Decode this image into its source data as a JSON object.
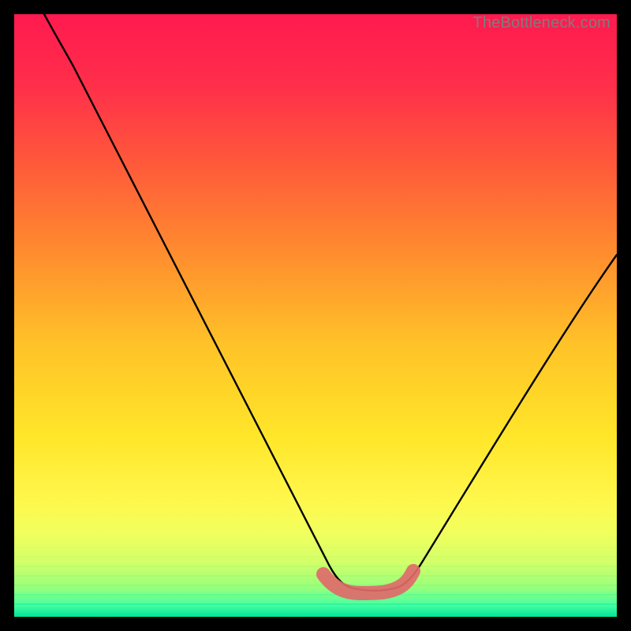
{
  "watermark": "TheBottleneck.com",
  "chart_data": {
    "type": "line",
    "title": "",
    "xlabel": "",
    "ylabel": "",
    "xlim": [
      0,
      100
    ],
    "ylim": [
      0,
      100
    ],
    "grid": false,
    "series": [
      {
        "name": "bottleneck-curve",
        "color": "#000000",
        "x": [
          5,
          10,
          15,
          20,
          25,
          30,
          35,
          40,
          45,
          50,
          52,
          55,
          58,
          60,
          63,
          65,
          70,
          75,
          80,
          85,
          90,
          95,
          100
        ],
        "y": [
          100,
          92,
          82,
          73,
          64,
          55,
          46,
          37,
          28,
          18,
          10,
          4,
          1,
          0.5,
          1,
          4,
          13,
          22,
          31,
          39,
          46,
          53,
          60
        ]
      },
      {
        "name": "minimum-band",
        "color": "#e46a6a",
        "x": [
          52,
          55,
          58,
          60,
          62,
          64
        ],
        "y": [
          3,
          1,
          0.5,
          0.5,
          1,
          3
        ]
      }
    ],
    "background_gradient": {
      "stops": [
        {
          "offset": 0.0,
          "color": "#ff1a4f"
        },
        {
          "offset": 0.12,
          "color": "#ff2f4a"
        },
        {
          "offset": 0.25,
          "color": "#ff5a3a"
        },
        {
          "offset": 0.4,
          "color": "#ff8e2e"
        },
        {
          "offset": 0.55,
          "color": "#ffc328"
        },
        {
          "offset": 0.7,
          "color": "#ffe629"
        },
        {
          "offset": 0.8,
          "color": "#fff64a"
        },
        {
          "offset": 0.86,
          "color": "#f2ff5d"
        },
        {
          "offset": 0.91,
          "color": "#d2ff6a"
        },
        {
          "offset": 0.95,
          "color": "#9cff7a"
        },
        {
          "offset": 0.98,
          "color": "#4affa0"
        },
        {
          "offset": 1.0,
          "color": "#00e59b"
        }
      ]
    }
  }
}
